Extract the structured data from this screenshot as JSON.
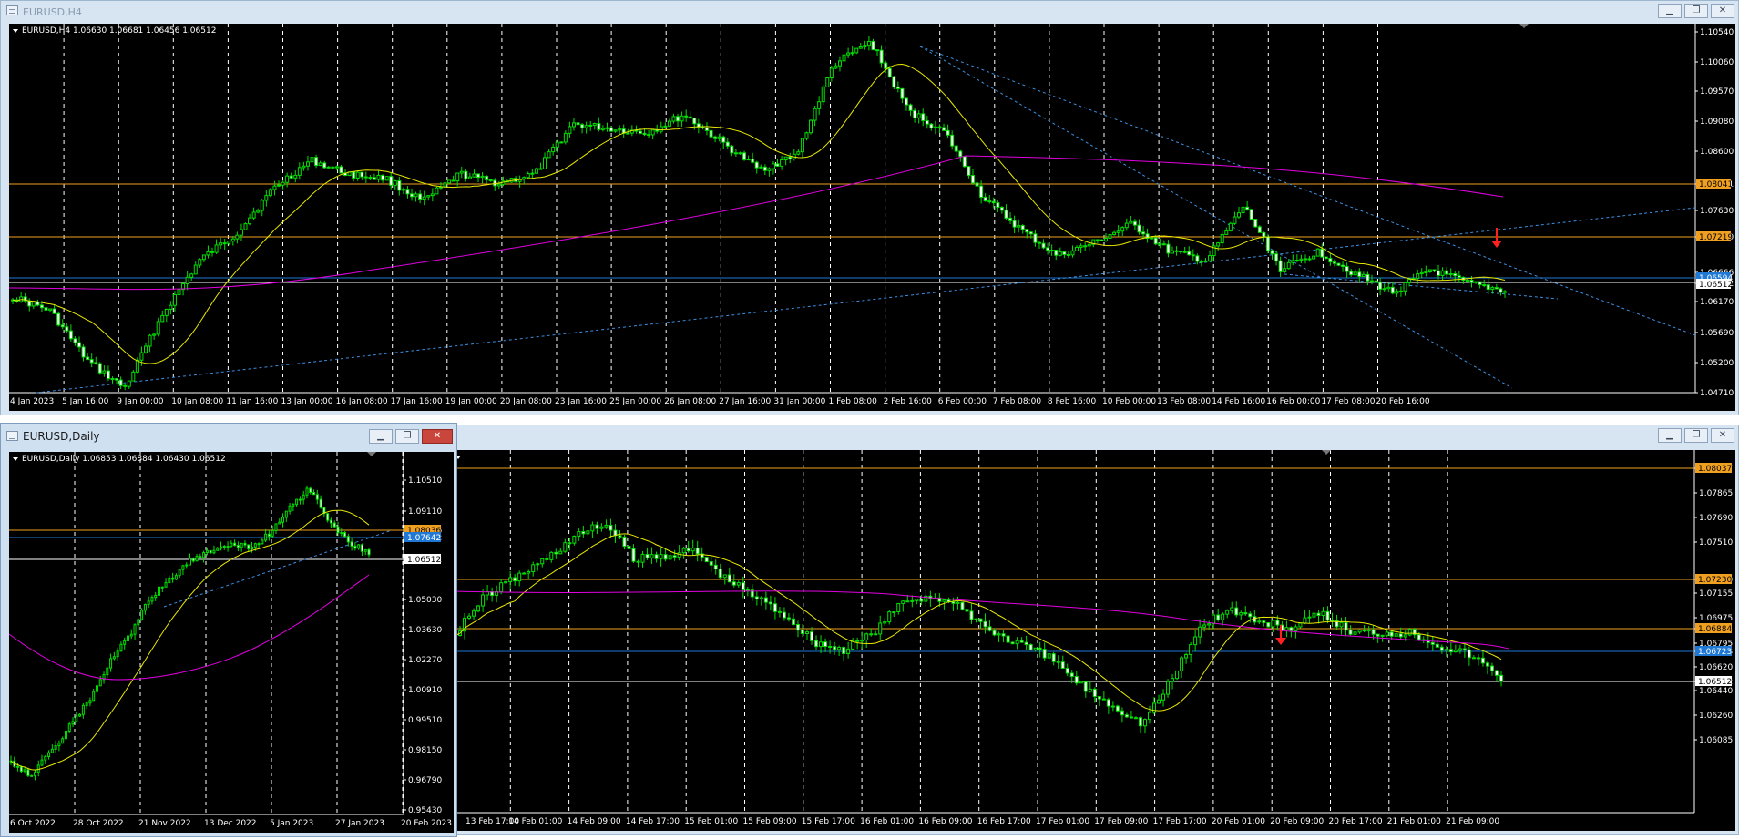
{
  "windows": {
    "h4": {
      "title": "EURUSD,H4",
      "info": "EURUSD,H4  1.06630 1.06681 1.06456 1.06512",
      "y_ticks": [
        "1.10540",
        "1.10060",
        "1.09570",
        "1.09080",
        "1.08600",
        "1.08041",
        "1.07630",
        "1.07219",
        "1.06666",
        "1.06512",
        "1.06170",
        "1.05690",
        "1.05200",
        "1.04710"
      ],
      "x_ticks": [
        "4 Jan 2023",
        "5 Jan 16:00",
        "9 Jan 00:00",
        "10 Jan 08:00",
        "11 Jan 16:00",
        "13 Jan 00:00",
        "16 Jan 08:00",
        "17 Jan 16:00",
        "19 Jan 00:00",
        "20 Jan 08:00",
        "23 Jan 16:00",
        "25 Jan 00:00",
        "26 Jan 08:00",
        "27 Jan 16:00",
        "31 Jan 00:00",
        "1 Feb 08:00",
        "2 Feb 16:00",
        "6 Feb 00:00",
        "7 Feb 08:00",
        "8 Feb 16:00",
        "10 Feb 00:00",
        "13 Feb 08:00",
        "14 Feb 16:00",
        "16 Feb 00:00",
        "17 Feb 08:00",
        "20 Feb 16:00"
      ],
      "price_labels": [
        {
          "text": "1.08041",
          "bg": "#f0a020",
          "color": "#000000"
        },
        {
          "text": "1.07219",
          "bg": "#f0a020",
          "color": "#000000"
        },
        {
          "text": "1.06594",
          "bg": "#1e78d4",
          "color": "#ffffff"
        },
        {
          "text": "1.06512",
          "bg": "#ffffff",
          "color": "#000000"
        }
      ]
    },
    "daily": {
      "title": "EURUSD,Daily",
      "info": "EURUSD,Daily  1.06853 1.06884 1.06430 1.06512",
      "y_ticks": [
        "1.10510",
        "1.09110",
        "1.08036",
        "1.07642",
        "1.06512",
        "1.05030",
        "1.03630",
        "1.02270",
        "1.00910",
        "0.99510",
        "0.98150",
        "0.96790",
        "0.95430"
      ],
      "x_ticks": [
        "6 Oct 2022",
        "28 Oct 2022",
        "21 Nov 2022",
        "13 Dec 2022",
        "5 Jan 2023",
        "27 Jan 2023",
        "20 Feb 2023"
      ],
      "price_labels": [
        {
          "text": "1.08036",
          "bg": "#f0a020",
          "color": "#000000"
        },
        {
          "text": "1.07642",
          "bg": "#1e78d4",
          "color": "#ffffff"
        },
        {
          "text": "1.06512",
          "bg": "#ffffff",
          "color": "#000000"
        }
      ]
    },
    "m30": {
      "y_ticks": [
        "1.08037",
        "1.07865",
        "1.07690",
        "1.07510",
        "1.07230",
        "1.07155",
        "1.06975",
        "1.06884",
        "1.06795",
        "1.06723",
        "1.06620",
        "1.06512",
        "1.06440",
        "1.06260",
        "1.06085"
      ],
      "x_ticks": [
        "13 Feb 17:00",
        "14 Feb 01:00",
        "14 Feb 09:00",
        "14 Feb 17:00",
        "15 Feb 01:00",
        "15 Feb 09:00",
        "15 Feb 17:00",
        "16 Feb 01:00",
        "16 Feb 09:00",
        "16 Feb 17:00",
        "17 Feb 01:00",
        "17 Feb 09:00",
        "17 Feb 17:00",
        "20 Feb 01:00",
        "20 Feb 09:00",
        "20 Feb 17:00",
        "21 Feb 01:00",
        "21 Feb 09:00"
      ],
      "price_labels": [
        {
          "text": "1.08037",
          "bg": "#f0a020",
          "color": "#000000"
        },
        {
          "text": "1.07230",
          "bg": "#f0a020",
          "color": "#000000"
        },
        {
          "text": "1.06884",
          "bg": "#f0a020",
          "color": "#000000"
        },
        {
          "text": "1.06723",
          "bg": "#1e78d4",
          "color": "#ffffff"
        },
        {
          "text": "1.06512",
          "bg": "#ffffff",
          "color": "#000000"
        }
      ]
    }
  },
  "icons": {
    "minimize": "minimize-icon",
    "restore": "restore-icon",
    "close": "close-icon",
    "window": "chart-window-icon"
  },
  "colors": {
    "candle": "#00e000",
    "ma_fast": "#e8e800",
    "ma_slow": "#e000e0",
    "level_orange": "#f0a020",
    "level_blue": "#1e78d4",
    "trendline": "#3c8fe0",
    "arrow": "#ff2020",
    "grid": "#ffffff"
  }
}
